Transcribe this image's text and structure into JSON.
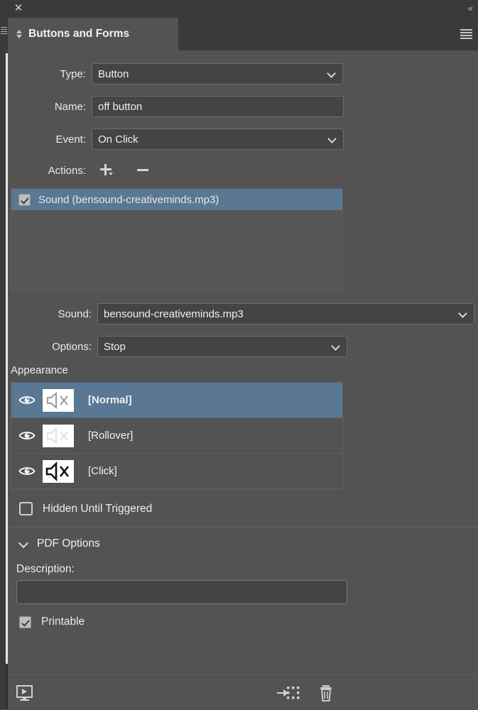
{
  "window": {
    "close_label": "✕",
    "collapse_label": "«"
  },
  "panel": {
    "tab_title": "Buttons and Forms",
    "menu_icon": "hamburger-menu-icon"
  },
  "form": {
    "type": {
      "label": "Type:",
      "value": "Button"
    },
    "name": {
      "label": "Name:",
      "value": "off button"
    },
    "event": {
      "label": "Event:",
      "value": "On Click"
    },
    "actions": {
      "label": "Actions:",
      "add_icon": "plus-icon",
      "remove_icon": "minus-icon",
      "items": [
        {
          "label": "Sound (bensound-creativeminds.mp3)",
          "checked": true,
          "selected": true
        }
      ]
    },
    "sound": {
      "label": "Sound:",
      "value": "bensound-creativeminds.mp3"
    },
    "options": {
      "label": "Options:",
      "value": "Stop"
    }
  },
  "appearance": {
    "title": "Appearance",
    "rows": [
      {
        "label": "[Normal]",
        "selected": true,
        "eye_icon": "eye-icon",
        "thumbnail_icon": "muted-speaker-icon"
      },
      {
        "label": "[Rollover]",
        "selected": false,
        "eye_icon": "eye-icon",
        "thumbnail_icon": "muted-speaker-icon"
      },
      {
        "label": "[Click]",
        "selected": false,
        "eye_icon": "eye-icon",
        "thumbnail_icon": "muted-speaker-icon"
      }
    ]
  },
  "hidden_until_triggered": {
    "label": "Hidden Until Triggered",
    "checked": false
  },
  "pdf_options": {
    "title": "PDF Options",
    "expanded": true,
    "description_label": "Description:",
    "description_value": "",
    "printable": {
      "label": "Printable",
      "checked": true
    }
  },
  "footer": {
    "preview_icon": "preview-monitor-icon",
    "convert_icon": "convert-to-object-icon",
    "delete_icon": "trash-icon"
  },
  "colors": {
    "panel_background": "#535353",
    "header_background": "#3a3a3a",
    "selection_blue": "#5a7794",
    "field_background": "#444444",
    "border": "#616161"
  }
}
